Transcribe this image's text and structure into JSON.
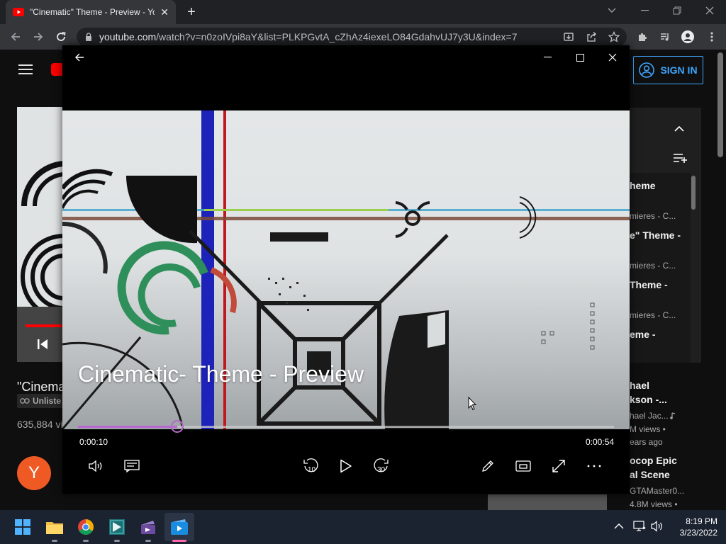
{
  "browser": {
    "tab_title": "\"Cinematic\" Theme - Preview - Yo",
    "url_domain": "youtube.com",
    "url_path": "/watch?v=n0zoIVpi8aY&list=PLKPGvtA_cZhAz4iexeLO84GdahvUJ7y3U&index=7"
  },
  "youtube": {
    "sign_in": "SIGN IN",
    "video_title_partial": "\"Cinema",
    "unlisted_badge": "Unliste",
    "views": "635,884 vi",
    "avatar_letter": "Y",
    "channel_partial": "...",
    "playlist": [
      {
        "title": "heme",
        "sub": "mieres - C..."
      },
      {
        "title": "e\" Theme -",
        "sub": "mieres - C..."
      },
      {
        "title": "Theme -",
        "sub": "mieres - C..."
      },
      {
        "title": "eme -",
        "sub": ""
      }
    ],
    "recommended": [
      {
        "title1": "hael",
        "title2": "kson -...",
        "channel": "hael Jac...",
        "meta1": "M views •",
        "meta2": "ears ago"
      },
      {
        "title1": "ocop Epic",
        "title2": "al Scene",
        "channel": "GTAMaster0...",
        "meta1": "4.8M views •",
        "meta2": ""
      }
    ]
  },
  "player": {
    "title": "Cinematic- Theme - Preview",
    "current_time": "0:00:10",
    "duration": "0:00:54",
    "progress": 0.185,
    "skip_back_label": "10",
    "skip_fwd_label": "30"
  },
  "taskbar": {
    "time": "8:19 PM",
    "date": "3/23/2022"
  },
  "colors": {
    "accent_purple": "#b868d0",
    "youtube_red": "#ff0000",
    "sign_in_blue": "#3ea6ff"
  }
}
